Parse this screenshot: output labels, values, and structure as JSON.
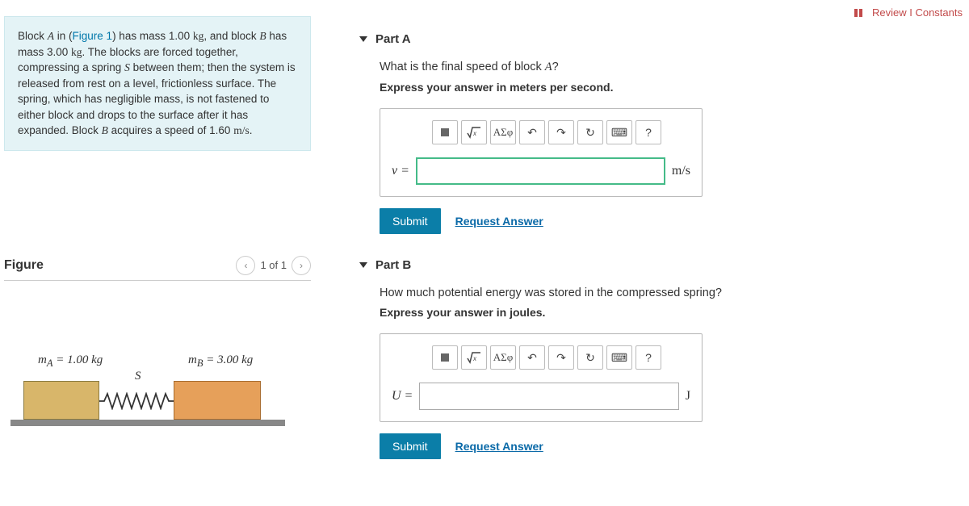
{
  "topLinks": {
    "review": "Review",
    "constants": "Constants"
  },
  "problem": {
    "text_pre": "Block ",
    "A": "A",
    "fig_in": " in (",
    "fig_link": "Figure 1",
    "text_1": ") has mass 1.00 ",
    "kg1": "kg",
    "text_2": ", and block ",
    "B": "B",
    "text_3": " has mass 3.00 ",
    "kg2": "kg",
    "text_4": ". The blocks are forced together, compressing a spring ",
    "S": "S",
    "text_5": " between them; then the system is released from rest on a level, frictionless surface. The spring, which has negligible mass, is not fastened to either block and drops to the surface after it has expanded. Block ",
    "B2": "B",
    "text_6": " acquires a speed of 1.60 ",
    "ms": "m/s",
    "text_7": "."
  },
  "figure": {
    "title": "Figure",
    "counter": "1 of 1",
    "mA": "m",
    "mA_sub": "A",
    "mA_eq": " = 1.00 kg",
    "S": "S",
    "mB": "m",
    "mB_sub": "B",
    "mB_eq": " = 3.00 kg"
  },
  "partA": {
    "title": "Part A",
    "question_pre": "What is the final speed of block ",
    "question_var": "A",
    "question_post": "?",
    "instruction": "Express your answer in meters per second.",
    "var": "v =",
    "unit": "m/s",
    "submit": "Submit",
    "request": "Request Answer",
    "greek": "ΑΣφ",
    "help": "?"
  },
  "partB": {
    "title": "Part B",
    "question": "How much potential energy was stored in the compressed spring?",
    "instruction": "Express your answer in joules.",
    "var": "U =",
    "unit": "J",
    "submit": "Submit",
    "request": "Request Answer",
    "greek": "ΑΣφ",
    "help": "?"
  }
}
